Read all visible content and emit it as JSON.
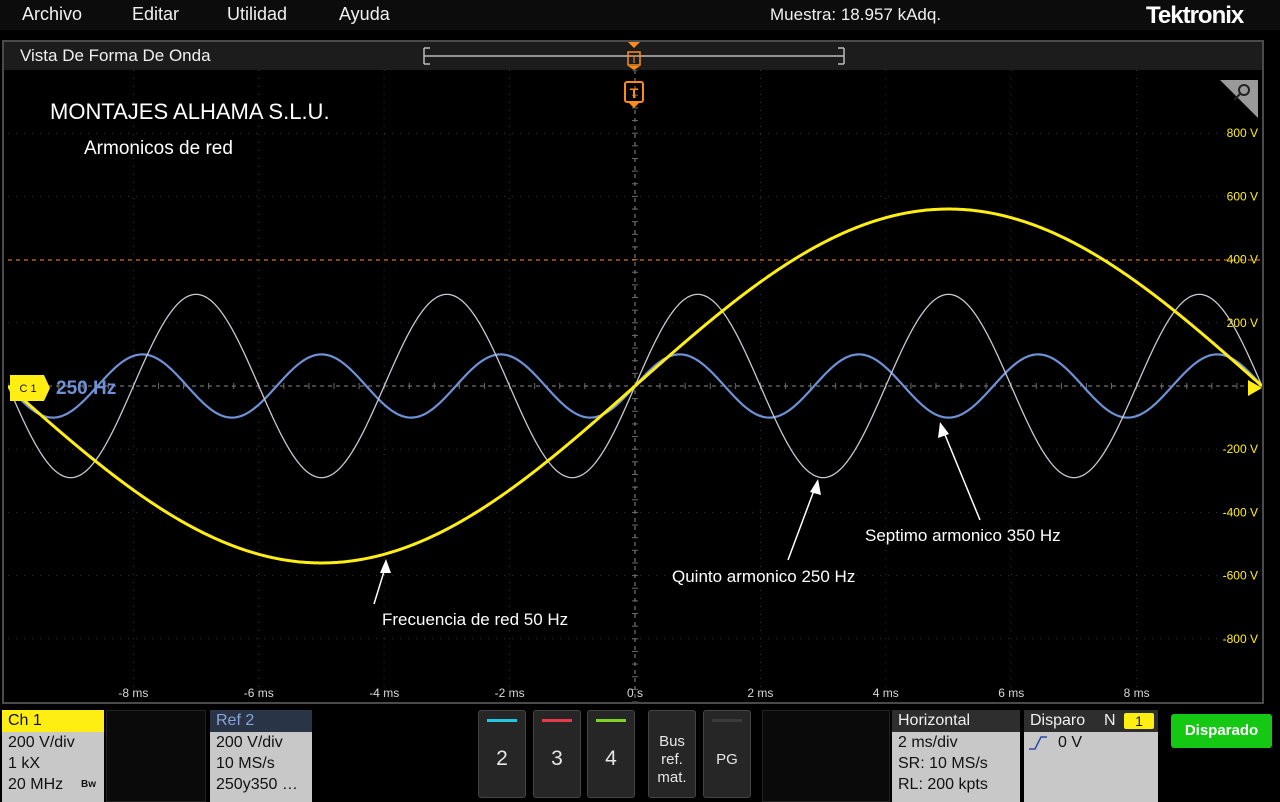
{
  "menu": {
    "items": [
      "Archivo",
      "Editar",
      "Utilidad",
      "Ayuda"
    ]
  },
  "header": {
    "sample_label": "Muestra: 18.957 kAdq.",
    "brand": "Tektronix"
  },
  "window": {
    "title": "Vista De Forma De Onda"
  },
  "annotations": {
    "company": "MONTAJES ALHAMA S.L.U.",
    "subtitle": "Armonicos de red",
    "fundamental": "Frecuencia de red 50 Hz",
    "fifth": "Quinto armonico 250 Hz",
    "seventh": "Septimo armonico 350 Hz",
    "ref_label": "250 Hz",
    "ch_marker": "C 1",
    "trigger_marker": "T"
  },
  "chart_data": {
    "type": "line",
    "xlabel": "",
    "ylabel": "",
    "xlim": [
      -10,
      10
    ],
    "ylim": [
      -1000,
      1000
    ],
    "x_ticks": [
      {
        "value": -8,
        "label": "-8 ms"
      },
      {
        "value": -6,
        "label": "-6 ms"
      },
      {
        "value": -4,
        "label": "-4 ms"
      },
      {
        "value": -2,
        "label": "-2 ms"
      },
      {
        "value": 0,
        "label": "0 s"
      },
      {
        "value": 2,
        "label": "2 ms"
      },
      {
        "value": 4,
        "label": "4 ms"
      },
      {
        "value": 6,
        "label": "6 ms"
      },
      {
        "value": 8,
        "label": "8 ms"
      }
    ],
    "y_ticks": [
      {
        "value": 800,
        "label": "800 V"
      },
      {
        "value": 600,
        "label": "600 V"
      },
      {
        "value": 400,
        "label": "400 V"
      },
      {
        "value": 200,
        "label": "200 V"
      },
      {
        "value": -200,
        "label": "-200 V"
      },
      {
        "value": -400,
        "label": "-400 V"
      },
      {
        "value": -600,
        "label": "-600 V"
      },
      {
        "value": -800,
        "label": "-800 V"
      }
    ],
    "series": [
      {
        "frequency_hz": 50,
        "amplitude_v": 560,
        "color": "#ffee11"
      },
      {
        "frequency_hz": 250,
        "amplitude_v": 290,
        "color": "#c8c8d2"
      },
      {
        "frequency_hz": 350,
        "amplitude_v": 100,
        "color": "#6f91d6"
      }
    ],
    "cursor_level_v": 400,
    "grid": true
  },
  "channels": {
    "ch1": {
      "label": "Ch 1",
      "scale": "200 V/div",
      "impedance": "1 kX",
      "bandwidth": "20 MHz",
      "bw_icon": "Bw"
    },
    "ref2": {
      "label": "Ref 2",
      "scale": "200 V/div",
      "rate": "10 MS/s",
      "name": "250y350 …"
    }
  },
  "buttons": {
    "ch2": "2",
    "ch3": "3",
    "ch4": "4",
    "bus1": "Bus",
    "bus2": "ref.",
    "bus3": "mat.",
    "pg": "PG"
  },
  "horizontal": {
    "title": "Horizontal",
    "scale": "2 ms/div",
    "sample_rate": "SR: 10 MS/s",
    "record_length": "RL: 200 kpts"
  },
  "trigger": {
    "title": "Disparo",
    "mode": "N",
    "source": "1",
    "level": "0 V"
  },
  "status": {
    "label": "Disparado"
  },
  "colors": {
    "ch1": "#ffee11",
    "harmonic5": "#c8c8d2",
    "harmonic7": "#6f91d6",
    "trigger": "#ff8c1a",
    "status": "#14c814"
  }
}
